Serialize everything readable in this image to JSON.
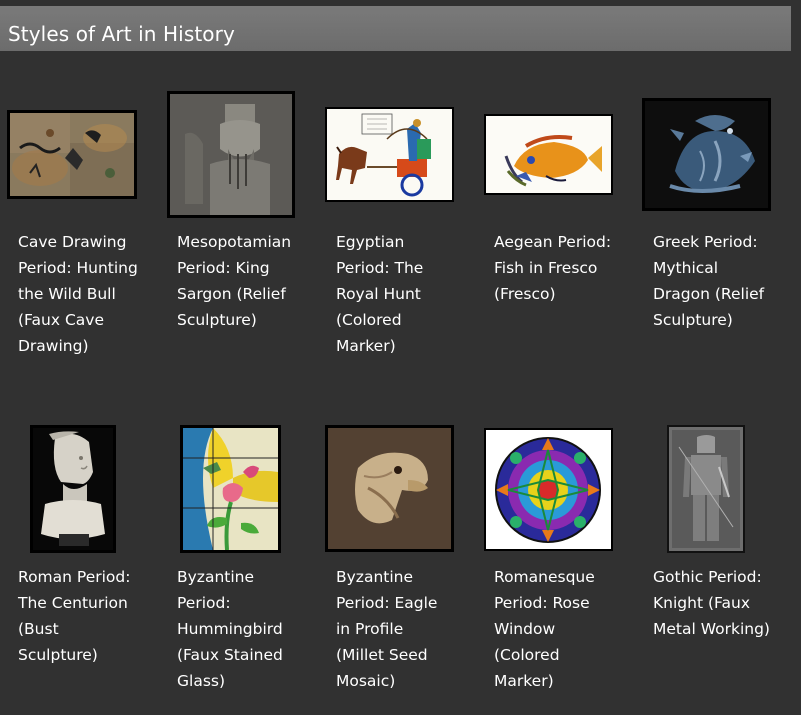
{
  "header": {
    "title": "Styles of Art in History"
  },
  "gallery": {
    "items": [
      {
        "caption": "Cave Drawing Period: Hunting the Wild Bull (Faux Cave Drawing)",
        "icon": "cave-drawing-image"
      },
      {
        "caption": "Mesopotamian Period: King Sargon (Relief Sculpture)",
        "icon": "king-sargon-relief-image"
      },
      {
        "caption": "Egyptian Period: The Royal Hunt (Colored Marker)",
        "icon": "royal-hunt-chariot-image"
      },
      {
        "caption": "Aegean Period: Fish in Fresco (Fresco)",
        "icon": "fish-fresco-image"
      },
      {
        "caption": "Greek Period: Mythical Dragon (Relief Sculpture)",
        "icon": "dragon-relief-image"
      },
      {
        "caption": "Roman Period: The Centurion (Bust Sculpture)",
        "icon": "centurion-bust-image"
      },
      {
        "caption": "Byzantine Period: Hummingbird (Faux Stained Glass)",
        "icon": "hummingbird-stained-glass-image"
      },
      {
        "caption": "Byzantine Period: Eagle in Profile (Millet Seed Mosaic)",
        "icon": "eagle-mosaic-image"
      },
      {
        "caption": "Romanesque Period: Rose Window (Colored Marker)",
        "icon": "rose-window-image"
      },
      {
        "caption": "Gothic Period: Knight (Faux Metal Working)",
        "icon": "knight-metal-image"
      }
    ]
  }
}
